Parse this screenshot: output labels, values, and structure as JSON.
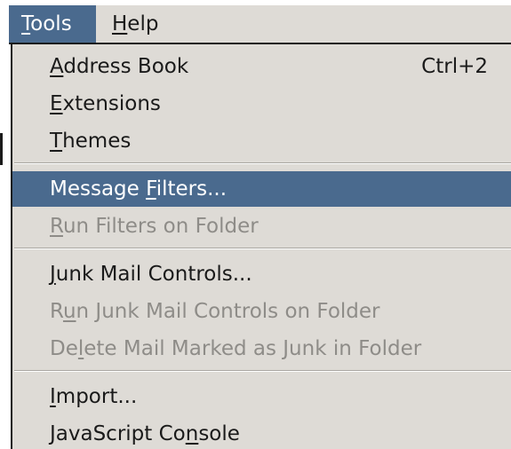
{
  "menubar": {
    "tools": {
      "pre": "",
      "acc": "T",
      "post": "ools"
    },
    "help": {
      "pre": "",
      "acc": "H",
      "post": "elp"
    }
  },
  "menu": {
    "items": [
      {
        "pre": "",
        "acc": "A",
        "post": "ddress Book",
        "shortcut": "Ctrl+2"
      },
      {
        "pre": "",
        "acc": "E",
        "post": "xtensions",
        "shortcut": ""
      },
      {
        "pre": "",
        "acc": "T",
        "post": "hemes",
        "shortcut": ""
      },
      {
        "pre": "Message ",
        "acc": "F",
        "post": "ilters...",
        "shortcut": ""
      },
      {
        "pre": "",
        "acc": "R",
        "post": "un Filters on Folder",
        "shortcut": ""
      },
      {
        "pre": "",
        "acc": "J",
        "post": "unk Mail Controls...",
        "shortcut": ""
      },
      {
        "pre": "R",
        "acc": "u",
        "post": "n Junk Mail Controls on Folder",
        "shortcut": ""
      },
      {
        "pre": "De",
        "acc": "l",
        "post": "ete Mail Marked as Junk in Folder",
        "shortcut": ""
      },
      {
        "pre": "",
        "acc": "I",
        "post": "mport...",
        "shortcut": ""
      },
      {
        "pre": "JavaScript Co",
        "acc": "n",
        "post": "sole",
        "shortcut": ""
      }
    ]
  },
  "colors": {
    "menu_bg": "#dedbd6",
    "highlight": "#4a6a8e",
    "disabled_text": "#8e8c88"
  }
}
